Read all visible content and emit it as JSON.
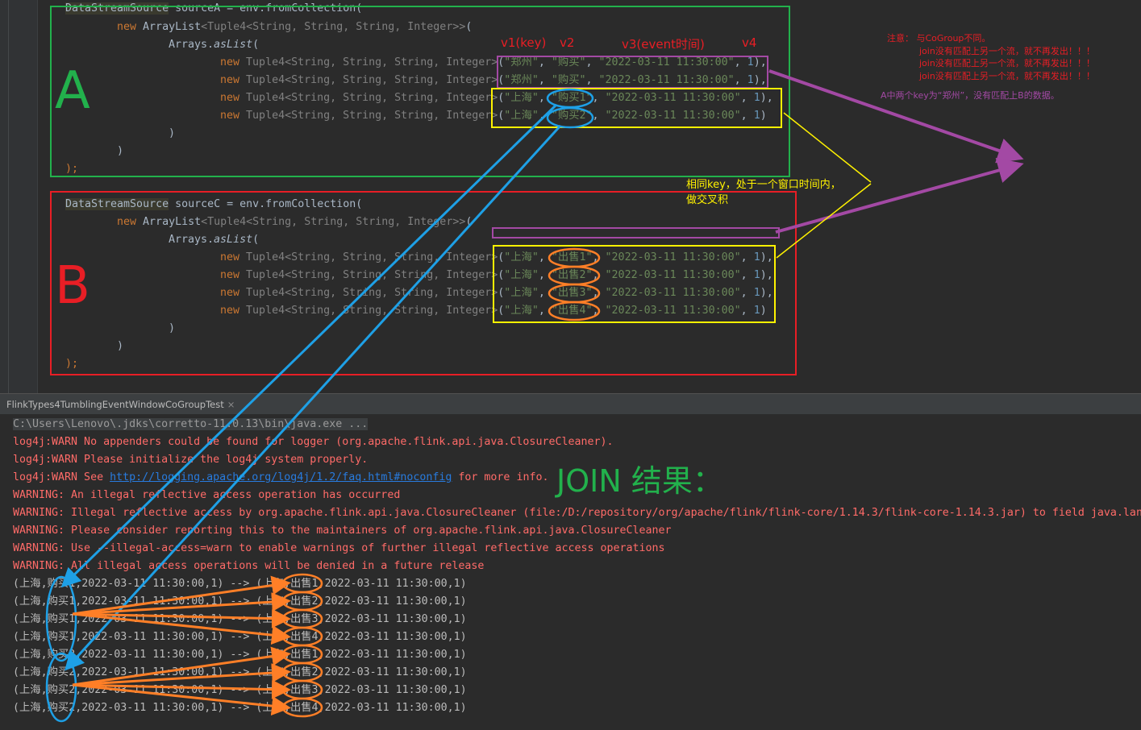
{
  "editor": {
    "sourceA": {
      "line1_type": "DataStreamSource",
      "line1_rest": " sourceA = env.fromCollection(",
      "line2_kw": "new",
      "line2_type": "ArrayList",
      "line2_gen": "<Tuple4<String, String, String, Integer>>",
      "line2_end": "(",
      "line3_cls": "Arrays.",
      "line3_fn": "asList",
      "line3_end": "(",
      "rows": [
        {
          "kw": "new",
          "tuple": "Tuple4<String, String, String, Integer>",
          "city": "\"郑州\"",
          "action": "\"购买\"",
          "time": "\"2022-03-11 11:30:00\"",
          "num": "1",
          "end": "),"
        },
        {
          "kw": "new",
          "tuple": "Tuple4<String, String, String, Integer>",
          "city": "\"郑州\"",
          "action": "\"购买\"",
          "time": "\"2022-03-11 11:30:00\"",
          "num": "1",
          "end": "),"
        },
        {
          "kw": "new",
          "tuple": "Tuple4<String, String, String, Integer>",
          "city": "\"上海\"",
          "action": "\"购买1\"",
          "time": "\"2022-03-11 11:30:00\"",
          "num": "1",
          "end": "),"
        },
        {
          "kw": "new",
          "tuple": "Tuple4<String, String, String, Integer>",
          "city": "\"上海\"",
          "action": "\"购买2\"",
          "time": "\"2022-03-11 11:30:00\"",
          "num": "1",
          "end": ")"
        }
      ],
      "close1": ")",
      "close2": ")",
      "close3": ");"
    },
    "sourceC": {
      "line1_type": "DataStreamSource",
      "line1_rest": " sourceC = env.fromCollection(",
      "line2_kw": "new",
      "line2_type": "ArrayList",
      "line2_gen": "<Tuple4<String, String, String, Integer>>",
      "line2_end": "(",
      "line3_cls": "Arrays.",
      "line3_fn": "asList",
      "line3_end": "(",
      "rows": [
        {
          "kw": "new",
          "tuple": "Tuple4<String, String, String, Integer>",
          "city": "\"上海\"",
          "action": "\"出售1\"",
          "time": "\"2022-03-11 11:30:00\"",
          "num": "1",
          "end": "),"
        },
        {
          "kw": "new",
          "tuple": "Tuple4<String, String, String, Integer>",
          "city": "\"上海\"",
          "action": "\"出售2\"",
          "time": "\"2022-03-11 11:30:00\"",
          "num": "1",
          "end": "),"
        },
        {
          "kw": "new",
          "tuple": "Tuple4<String, String, String, Integer>",
          "city": "\"上海\"",
          "action": "\"出售3\"",
          "time": "\"2022-03-11 11:30:00\"",
          "num": "1",
          "end": "),"
        },
        {
          "kw": "new",
          "tuple": "Tuple4<String, String, String, Integer>",
          "city": "\"上海\"",
          "action": "\"出售4\"",
          "time": "\"2022-03-11 11:30:00\"",
          "num": "1",
          "end": ")"
        }
      ],
      "close1": ")",
      "close2": ")",
      "close3": ");"
    }
  },
  "annotations": {
    "label_a": "A",
    "label_b": "B",
    "headers": [
      "v1(key)",
      "v2",
      "v3(event时间)",
      "v4"
    ],
    "note_lines": [
      "注意： 与CoGroup不同。",
      "join没有匹配上另一个流，就不再发出！！！",
      "join没有匹配上另一个流，就不再发出！！！",
      "join没有匹配上另一个流，就不再发出！！！"
    ],
    "note_purple": "A中两个key为“郑州”，没有匹配上B的数据。",
    "cross_note_1": "相同key，处于一个窗口时间内，",
    "cross_note_2": "做交叉积",
    "join_result": "JOIN 结果："
  },
  "tab": {
    "label": "FlinkTypes4TumblingEventWindowCoGroupTest",
    "close": "×"
  },
  "console": {
    "command": "C:\\Users\\Lenovo\\.jdks\\corretto-11.0.13\\bin\\java.exe ...",
    "warn1": "log4j:WARN No appenders could be found for logger (org.apache.flink.api.java.ClosureCleaner).",
    "warn2": "log4j:WARN Please initialize the log4j system properly.",
    "warn3_pre": "log4j:WARN See ",
    "warn3_link": "http://logging.apache.org/log4j/1.2/faq.html#noconfig",
    "warn3_post": " for more info.",
    "warnings": [
      "WARNING: An illegal reflective access operation has occurred",
      "WARNING: Illegal reflective access by org.apache.flink.api.java.ClosureCleaner (file:/D:/repository/org/apache/flink/flink-core/1.14.3/flink-core-1.14.3.jar) to field java.lang",
      "WARNING: Please consider reporting this to the maintainers of org.apache.flink.api.java.ClosureCleaner",
      "WARNING: Use --illegal-access=warn to enable warnings of further illegal reflective access operations",
      "WARNING: All illegal access operations will be denied in a future release"
    ],
    "results": [
      "(上海,购买1,2022-03-11 11:30:00,1) --> (上海,出售1,2022-03-11 11:30:00,1)",
      "(上海,购买1,2022-03-11 11:30:00,1) --> (上海,出售2,2022-03-11 11:30:00,1)",
      "(上海,购买1,2022-03-11 11:30:00,1) --> (上海,出售3,2022-03-11 11:30:00,1)",
      "(上海,购买1,2022-03-11 11:30:00,1) --> (上海,出售4,2022-03-11 11:30:00,1)",
      "(上海,购买2,2022-03-11 11:30:00,1) --> (上海,出售1,2022-03-11 11:30:00,1)",
      "(上海,购买2,2022-03-11 11:30:00,1) --> (上海,出售2,2022-03-11 11:30:00,1)",
      "(上海,购买2,2022-03-11 11:30:00,1) --> (上海,出售3,2022-03-11 11:30:00,1)",
      "(上海,购买2,2022-03-11 11:30:00,1) --> (上海,出售4,2022-03-11 11:30:00,1)"
    ]
  },
  "colors": {
    "green": "#22b14c",
    "red": "#e81e25",
    "purple": "#a349a4",
    "yellow": "#fff200",
    "blue": "#1ea0e6",
    "orange": "#ff7f27"
  }
}
